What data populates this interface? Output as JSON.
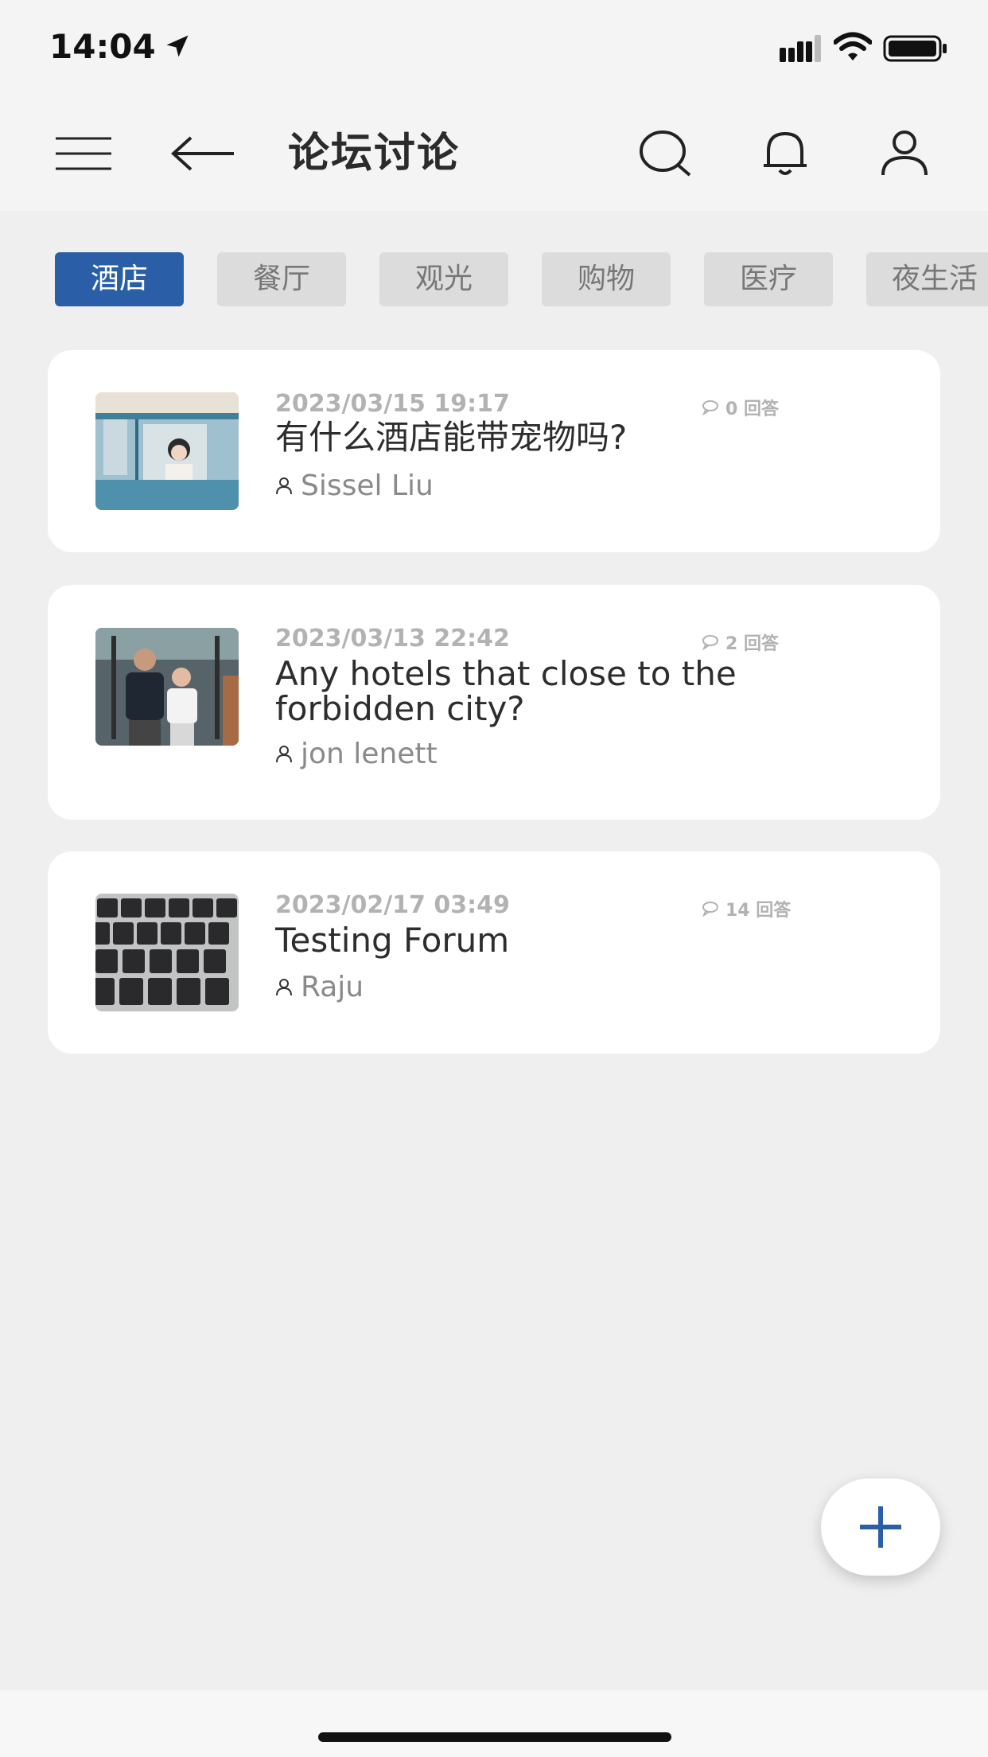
{
  "status_bar": {
    "time": "14:04"
  },
  "header": {
    "title": "论坛讨论"
  },
  "tabs": [
    {
      "label": "酒店",
      "active": true
    },
    {
      "label": "餐厅",
      "active": false
    },
    {
      "label": "观光",
      "active": false
    },
    {
      "label": "购物",
      "active": false
    },
    {
      "label": "医疗",
      "active": false
    },
    {
      "label": "夜生活",
      "active": false
    }
  ],
  "posts": [
    {
      "date": "2023/03/15 19:17",
      "replies": "0 回答",
      "title": "有什么酒店能带宠物吗?",
      "author": "Sissel Liu"
    },
    {
      "date": "2023/03/13 22:42",
      "replies": "2 回答",
      "title": "Any hotels that close to the forbidden city?",
      "author": "jon lenett"
    },
    {
      "date": "2023/02/17 03:49",
      "replies": "14 回答",
      "title": "Testing Forum",
      "author": "Raju"
    }
  ],
  "colors": {
    "accent": "#2a5fa8",
    "background": "#efeff0",
    "card": "#ffffff"
  }
}
